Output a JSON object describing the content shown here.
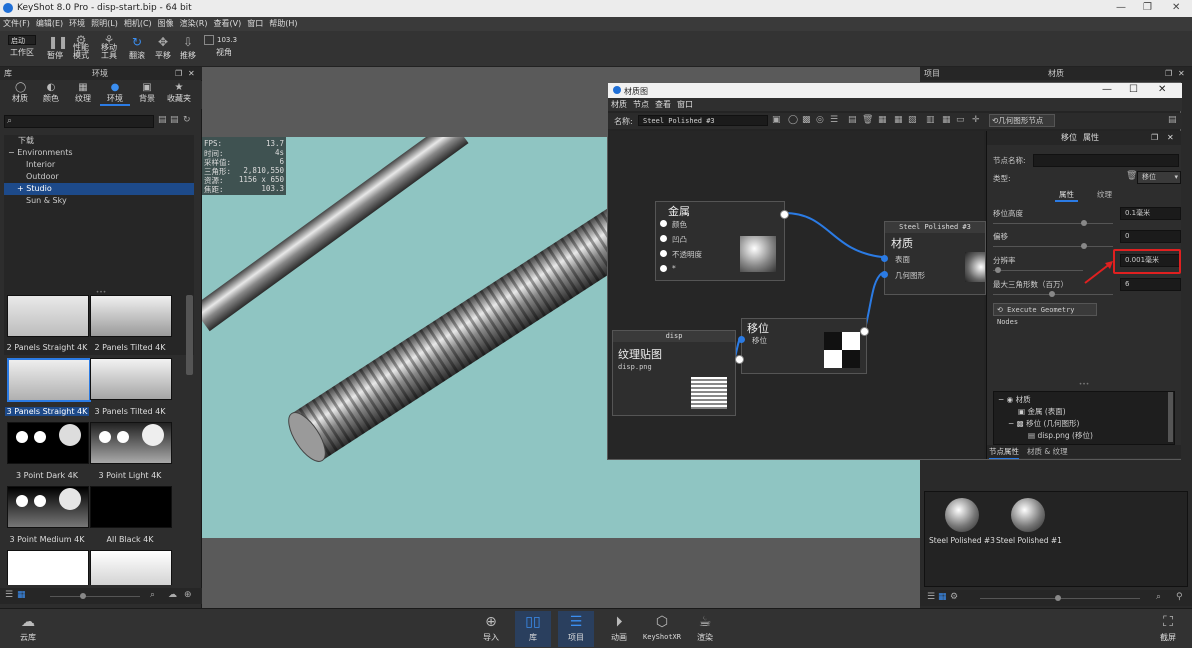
{
  "window": {
    "title": "KeyShot 8.0 Pro - disp-start.bip - 64 bit"
  },
  "menu": [
    "文件(F)",
    "编辑(E)",
    "环境",
    "照明(L)",
    "相机(C)",
    "图像",
    "渲染(R)",
    "查看(V)",
    "窗口",
    "帮助(H)"
  ],
  "toolbar": {
    "workspace_select": "启动",
    "workspace_label": "工作区",
    "pause": "暂停",
    "perf_line1": "性能",
    "perf_line2": "模式",
    "move_line1": "移动",
    "move_line2": "工具",
    "rotate": "翻滚",
    "pan": "平移",
    "dolly": "推移",
    "fov_value": "103.3",
    "fov_label": "视角"
  },
  "library": {
    "title": "库",
    "tab_header": "环境",
    "tabs": [
      "材质",
      "颜色",
      "纹理",
      "环境",
      "背景",
      "收藏夹"
    ],
    "tree": {
      "root": "下载",
      "items": [
        "Environments",
        "Interior",
        "Outdoor",
        "Studio",
        "Sun & Sky"
      ]
    },
    "thumbs": [
      "2 Panels Straight 4K",
      "2 Panels Tilted 4K",
      "3 Panels Straight 4K",
      "3 Panels Tilted 4K",
      "3 Point Dark 4K",
      "3 Point Light 4K",
      "3 Point Medium 4K",
      "All Black 4K"
    ]
  },
  "stats": {
    "fps_label": "FPS:",
    "fps": "13.7",
    "time_label": "时间:",
    "time": "4s",
    "samples_label": "采样值:",
    "samples": "6",
    "tris_label": "三角形:",
    "tris": "2,810,550",
    "res_label": "资源:",
    "res": "1156 x 650",
    "focal_label": "焦距:",
    "focal": "103.3"
  },
  "project_panel": {
    "header_left": "项目",
    "header_mid": "材质"
  },
  "material_graph": {
    "title": "材质图",
    "menu": [
      "材质",
      "节点",
      "查看",
      "窗口"
    ],
    "name_label": "名称:",
    "name_value": "Steel Polished #3",
    "geom_button": "几何图形节点",
    "nodes": {
      "metal": {
        "title": "金属",
        "ports": [
          "颜色",
          "凹凸",
          "不透明度",
          "*"
        ]
      },
      "material": {
        "header": "Steel Polished #3",
        "title": "材质",
        "ports": [
          "表面",
          "几何图形"
        ]
      },
      "disp": {
        "header": "disp",
        "title": "移位",
        "ports": [
          "移位"
        ]
      },
      "texture": {
        "title": "纹理贴图",
        "file": "disp.png"
      }
    },
    "props": {
      "title_left": "移位",
      "title_right": "属性",
      "node_name_label": "节点名称:",
      "type_label": "类型:",
      "type_value": "移位",
      "tab_props": "属性",
      "tab_texture": "纹理",
      "height_label": "移位高度",
      "height_value": "0.1毫米",
      "offset_label": "偏移",
      "offset_value": "0",
      "resolution_label": "分辨率",
      "resolution_value": "0.001毫米",
      "maxtri_label": "最大三角形数（百万）",
      "maxtri_value": "6",
      "execute_button": "Execute Geometry Nodes",
      "tree": [
        "材质",
        "金属 (表面)",
        "移位 (几何图形)",
        "disp.png (移位)"
      ],
      "bottom_tabs": [
        "节点属性",
        "材质 & 纹理"
      ]
    }
  },
  "materials_list": [
    "Steel Polished #3",
    "Steel Polished #1"
  ],
  "bottom": {
    "cloud": "云库",
    "import": "导入",
    "library": "库",
    "project": "项目",
    "animation": "动画",
    "keyshotxr": "KeyShotXR",
    "render": "渲染",
    "screenshot": "截屏"
  },
  "colors": {
    "accent": "#2b7be4",
    "highlight": "#e02020"
  }
}
